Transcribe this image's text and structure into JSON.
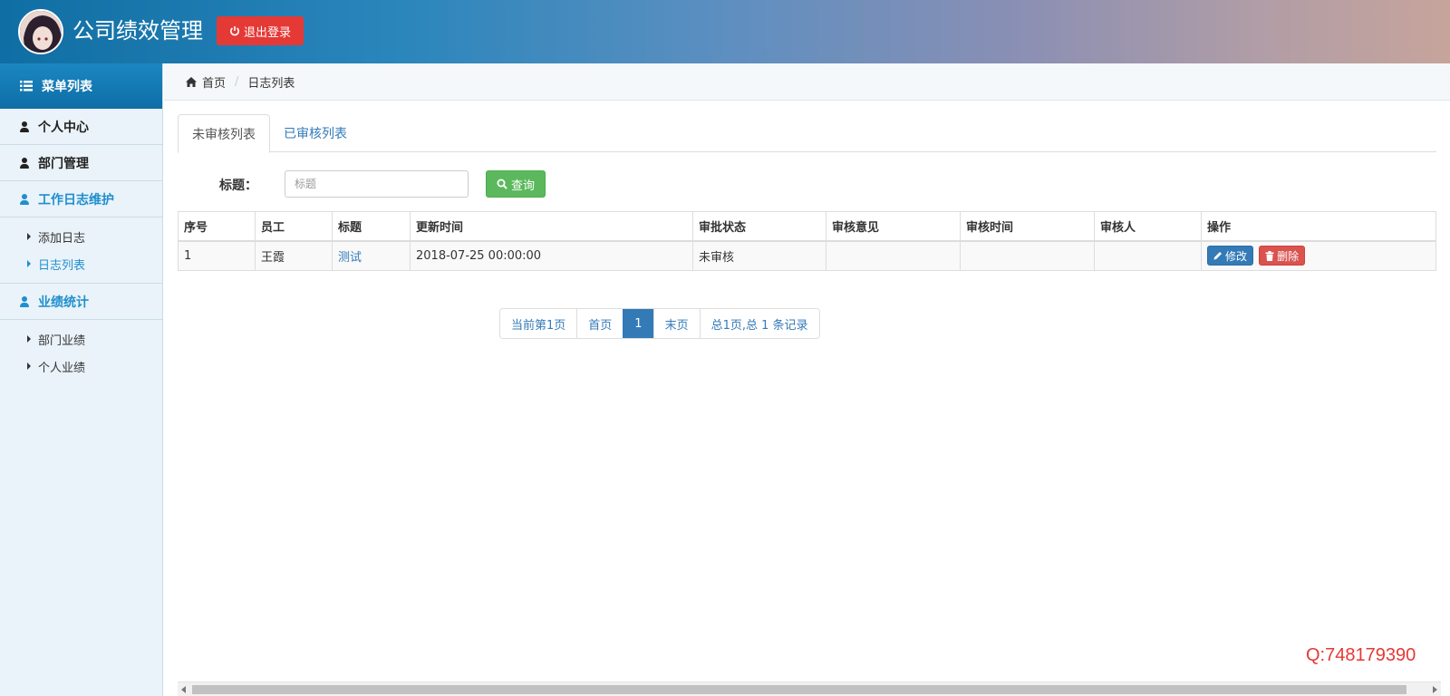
{
  "header": {
    "app_title": "公司绩效管理",
    "logout_label": "退出登录",
    "accent_color": "#0f6ea3",
    "logout_color": "#e53935"
  },
  "sidebar": {
    "menu_title": "菜单列表",
    "groups": [
      {
        "label": "个人中心",
        "icon": "user-icon"
      },
      {
        "label": "部门管理",
        "icon": "user-icon"
      },
      {
        "label": "工作日志维护",
        "icon": "user-icon",
        "active": true,
        "items": [
          {
            "label": "添加日志"
          },
          {
            "label": "日志列表",
            "active": true
          }
        ]
      },
      {
        "label": "业绩统计",
        "icon": "user-icon",
        "items": [
          {
            "label": "部门业绩"
          },
          {
            "label": "个人业绩"
          }
        ]
      }
    ]
  },
  "breadcrumb": {
    "home": "首页",
    "current": "日志列表"
  },
  "tabs": [
    {
      "label": "未审核列表",
      "active": true
    },
    {
      "label": "已审核列表"
    }
  ],
  "search": {
    "label": "标题：",
    "placeholder": "标题",
    "button": "查询"
  },
  "table": {
    "columns": [
      "序号",
      "员工",
      "标题",
      "更新时间",
      "审批状态",
      "审核意见",
      "审核时间",
      "审核人",
      "操作"
    ],
    "rows": [
      {
        "index": "1",
        "employee": "王霞",
        "title": "测试",
        "updated": "2018-07-25 00:00:00",
        "status": "未审核",
        "opinion": "",
        "review_time": "",
        "reviewer": "",
        "edit_label": "修改",
        "delete_label": "删除"
      }
    ]
  },
  "pagination": {
    "current_text": "当前第1页",
    "first": "首页",
    "page": "1",
    "last": "末页",
    "summary": "总1页,总 1 条记录"
  },
  "watermark": "Q:748179390"
}
